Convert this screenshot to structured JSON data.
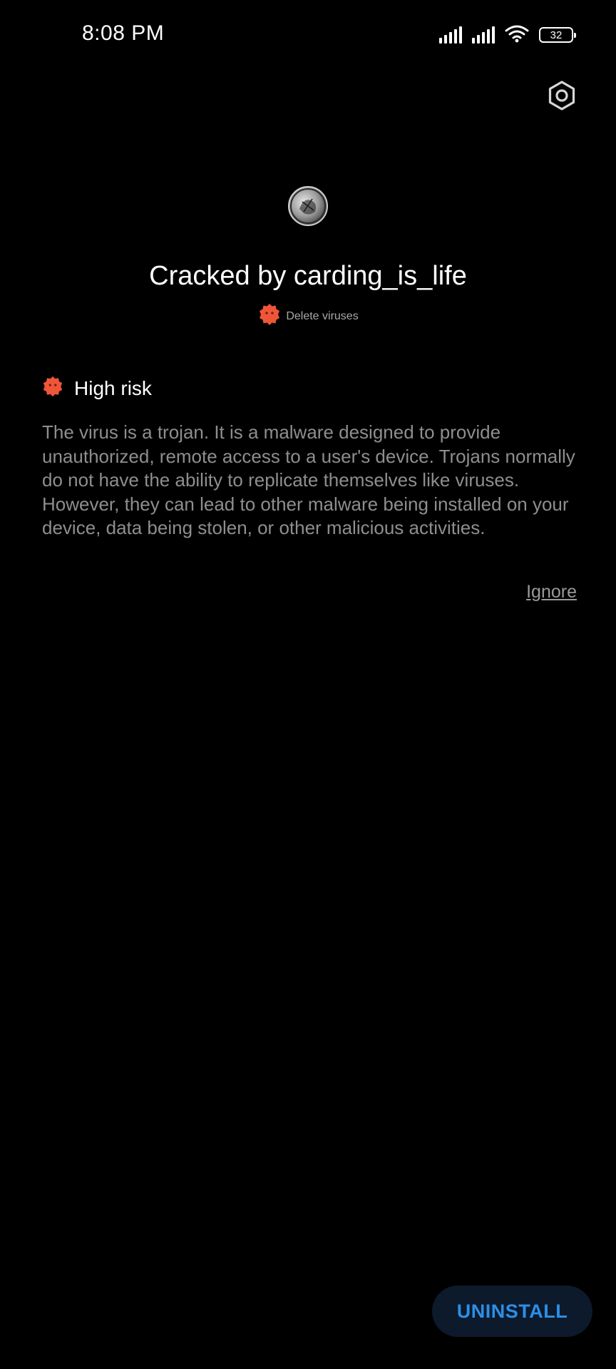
{
  "status_bar": {
    "time": "8:08 PM",
    "battery_level": "32",
    "icons": [
      "signal-icon",
      "signal-icon",
      "wifi-icon",
      "battery-icon"
    ]
  },
  "header": {
    "settings_icon": "gear-icon"
  },
  "app": {
    "title": "Cracked by carding_is_life",
    "icon": "app-icon",
    "threat_tag": {
      "icon": "virus-icon",
      "label": "Delete viruses"
    }
  },
  "risk": {
    "icon": "virus-icon",
    "label": "High risk",
    "description": "The virus is a trojan. It is a malware designed to provide unauthorized, remote access to a user's device. Trojans normally do not have the ability to replicate themselves like viruses. However, they can lead to other malware being installed on your device, data being stolen, or other malicious activities."
  },
  "actions": {
    "ignore_label": "Ignore",
    "uninstall_label": "UNINSTALL"
  },
  "colors": {
    "background": "#000000",
    "danger": "#f0553a",
    "accent": "#2b8fe8",
    "button_bg": "#0c1a2b",
    "muted_text": "#8e8e8e"
  }
}
